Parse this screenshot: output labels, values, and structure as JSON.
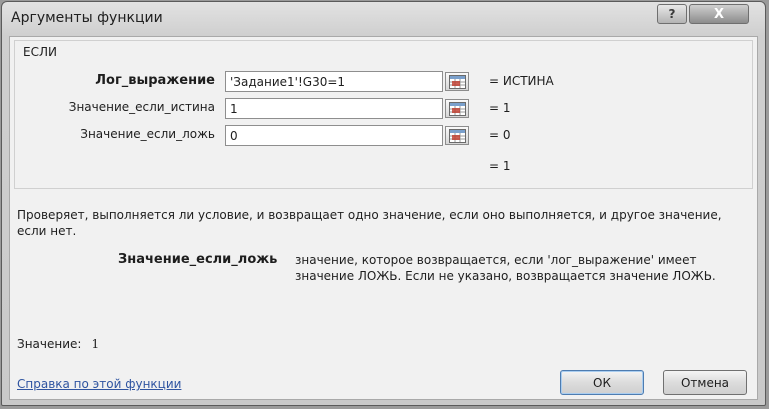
{
  "window": {
    "title": "Аргументы функции",
    "help_label": "?",
    "close_label": "X"
  },
  "function_name": "ЕСЛИ",
  "arguments": [
    {
      "label": "Лог_выражение",
      "value": "'Задание1'!G30=1",
      "result": "=  ИСТИНА"
    },
    {
      "label": "Значение_если_истина",
      "value": "1",
      "result": "=  1"
    },
    {
      "label": "Значение_если_ложь",
      "value": "0",
      "result": "=  0"
    }
  ],
  "formula_result": "=  1",
  "description": "Проверяет, выполняется ли условие, и возвращает одно значение, если оно выполняется, и другое значение, если нет.",
  "arg_help": {
    "name": "Значение_если_ложь",
    "text": "значение, которое возвращается, если 'лог_выражение' имеет значение ЛОЖЬ. Если не указано, возвращается значение ЛОЖЬ."
  },
  "value": {
    "label": "Значение:",
    "number": "1"
  },
  "help_link": "Справка по этой функции",
  "buttons": {
    "ok": "ОК",
    "cancel": "Отмена"
  },
  "icons": {
    "ref": "collapse-dialog-icon",
    "help": "help-icon",
    "close": "close-icon"
  },
  "colors": {
    "link": "#2f54a0",
    "dialog_bg": "#f1f1f1"
  }
}
